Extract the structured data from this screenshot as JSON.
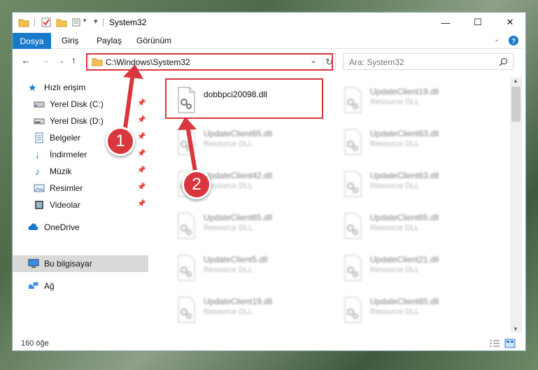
{
  "window": {
    "title": "System32"
  },
  "ribbon": {
    "file_tab": "Dosya",
    "tabs": [
      "Giriş",
      "Paylaş",
      "Görünüm"
    ]
  },
  "address": {
    "path": "C:\\Windows\\System32",
    "search_placeholder": "Ara: System32"
  },
  "sidebar": {
    "items": [
      {
        "label": "Hızlı erişim",
        "icon": "star-icon",
        "pinned": false
      },
      {
        "label": "Yerel Disk (C:)",
        "icon": "drive-icon",
        "pinned": true
      },
      {
        "label": "Yerel Disk (D:)",
        "icon": "drive-icon",
        "pinned": true
      },
      {
        "label": "Belgeler",
        "icon": "documents-icon",
        "pinned": true
      },
      {
        "label": "İndirmeler",
        "icon": "downloads-icon",
        "pinned": true
      },
      {
        "label": "Müzik",
        "icon": "music-icon",
        "pinned": true
      },
      {
        "label": "Resimler",
        "icon": "pictures-icon",
        "pinned": true
      },
      {
        "label": "Videolar",
        "icon": "videos-icon",
        "pinned": true
      },
      {
        "label": "OneDrive",
        "icon": "cloud-icon",
        "pinned": false
      },
      {
        "label": "Bu bilgisayar",
        "icon": "computer-icon",
        "pinned": false
      },
      {
        "label": "Ağ",
        "icon": "network-icon",
        "pinned": false
      }
    ]
  },
  "files": {
    "highlighted": {
      "name": "dobbpci20098.dll"
    },
    "col1": [
      {
        "name": "UpdateClient65.dll",
        "type": "Resource DLL"
      },
      {
        "name": "UpdateClient42.dll",
        "type": "Resource DLL"
      },
      {
        "name": "UpdateClient65.dll",
        "type": "Resource DLL"
      },
      {
        "name": "UpdateClient5.dll",
        "type": "Resource DLL"
      },
      {
        "name": "UpdateClient19.dll",
        "type": "Resource DLL"
      }
    ],
    "col2": [
      {
        "name": "UpdateClient19.dll",
        "type": "Resource DLL"
      },
      {
        "name": "UpdateClient63.dll",
        "type": "Resource DLL"
      },
      {
        "name": "UpdateClient63.dll",
        "type": "Resource DLL"
      },
      {
        "name": "UpdateClient65.dll",
        "type": "Resource DLL"
      },
      {
        "name": "UpdateClient21.dll",
        "type": "Resource DLL"
      },
      {
        "name": "UpdateClient65.dll",
        "type": "Resource DLL"
      }
    ]
  },
  "status": {
    "item_count": "160 öğe"
  },
  "annotations": {
    "step1": "1",
    "step2": "2",
    "color": "#d9363e"
  },
  "colors": {
    "accent": "#1979ca",
    "selected_nav": "#d9d9d9"
  }
}
